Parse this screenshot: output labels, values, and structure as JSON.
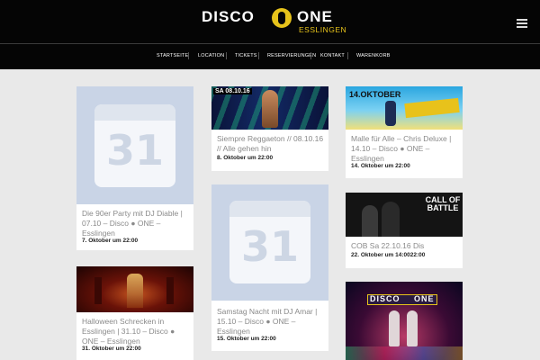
{
  "brand": {
    "name_left": "DISCO",
    "name_right": "ONE",
    "sub": "ESSLINGEN",
    "color": "#e7c31b"
  },
  "nav": [
    "STARTSEITE",
    "LOCATION",
    "TICKETS",
    "RESERVIERUNGEN",
    "KONTAKT",
    "WARENKORB"
  ],
  "events": [
    {
      "title": "Die 90er Party mit DJ Diable | 07.10 – Disco ● ONE – Esslingen",
      "date": "7. Oktober um 22:00"
    },
    {
      "title": "Halloween Schrecken in Esslingen | 31.10 – Disco ● ONE – Esslingen",
      "date": "31. Oktober um 22:00"
    },
    {
      "title": "Siempre Reggaeton // 08.10.16 // Alle gehen hin",
      "date": "8. Oktober um 22:00",
      "poster_date": "SA 08.10.16"
    },
    {
      "title": "Samstag Nacht mit DJ Amar | 15.10 – Disco ● ONE – Esslingen",
      "date": "15. Oktober um 22:00"
    },
    {
      "title": "Malle für Alle – Chris Deluxe | 14.10 – Disco ● ONE – Esslingen",
      "date": "14. Oktober um 22:00",
      "poster_date": "14.OKTOBER"
    },
    {
      "title": "COB Sa 22.10.16 Dis",
      "date": "22. Oktober um 14:0022:00",
      "poster_text": "CALL OF BATTLE"
    },
    {
      "title": "",
      "date": ""
    }
  ],
  "placeholder_number": "31"
}
